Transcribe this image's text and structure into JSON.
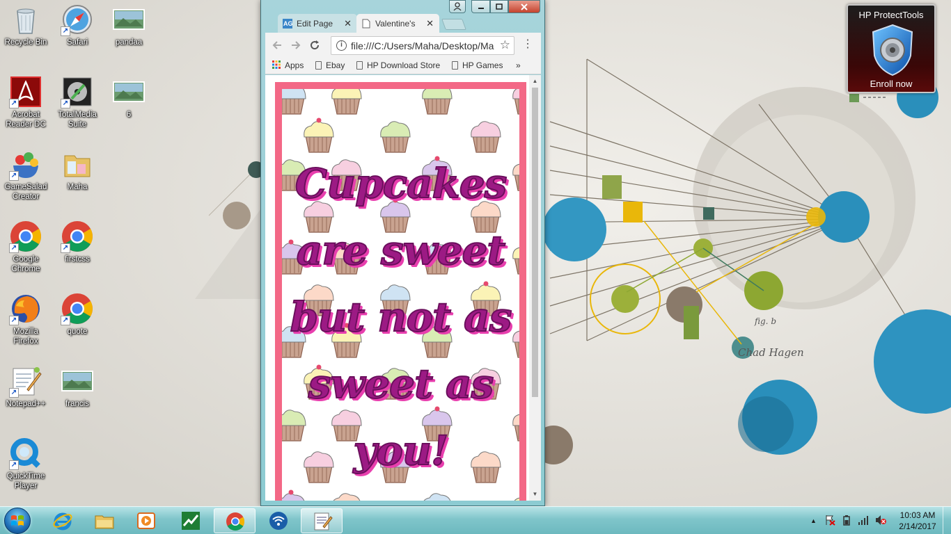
{
  "desktop": {
    "icons": [
      {
        "label": "Recycle Bin",
        "icon": "recycle-bin-icon"
      },
      {
        "label": "Safari",
        "icon": "safari-icon"
      },
      {
        "label": "pandaa",
        "icon": "image-file-icon"
      },
      {
        "label": "Acrobat Reader DC",
        "icon": "acrobat-icon"
      },
      {
        "label": "TotalMedia Suite",
        "icon": "totalmedia-icon"
      },
      {
        "label": "6",
        "icon": "image-file-icon"
      },
      {
        "label": "GameSalad Creator",
        "icon": "gamesalad-icon"
      },
      {
        "label": "Maha",
        "icon": "folder-icon"
      },
      {
        "label": "Google Chrome",
        "icon": "chrome-icon"
      },
      {
        "label": "firstcss",
        "icon": "chrome-icon"
      },
      {
        "label": "Mozilla Firefox",
        "icon": "firefox-icon"
      },
      {
        "label": "quote",
        "icon": "chrome-icon"
      },
      {
        "label": "Notepad++",
        "icon": "notepad-plus-icon"
      },
      {
        "label": "francis",
        "icon": "image-file-icon"
      },
      {
        "label": "QuickTime Player",
        "icon": "quicktime-icon"
      }
    ]
  },
  "hp_widget": {
    "title": "HP ProtectTools",
    "action": "Enroll now"
  },
  "browser": {
    "tabs": [
      {
        "label": "Edit Page",
        "favicon": "AG",
        "close": "✕"
      },
      {
        "label": "Valentine's",
        "close": "✕"
      }
    ],
    "address": "file:///C:/Users/Maha/Desktop/Ma",
    "bookmarks": [
      {
        "label": "Apps"
      },
      {
        "label": "Ebay"
      },
      {
        "label": "HP Download Store"
      },
      {
        "label": "HP Games"
      }
    ],
    "bookmarks_overflow": "»",
    "page": {
      "quote_lines": [
        "Cupcakes",
        "are sweet",
        "but not as",
        "sweet as",
        "you!"
      ],
      "frame_color": "#f36886",
      "text_color": "#9c1a84"
    }
  },
  "wallpaper": {
    "signature": "Chad Hagen",
    "fig_label": "fig. b"
  },
  "taskbar": {
    "items": [
      "internet-explorer",
      "file-explorer",
      "media-player",
      "stock-app",
      "chrome",
      "wifi-app",
      "notepad"
    ],
    "clock_time": "10:03 AM",
    "clock_date": "2/14/2017"
  }
}
